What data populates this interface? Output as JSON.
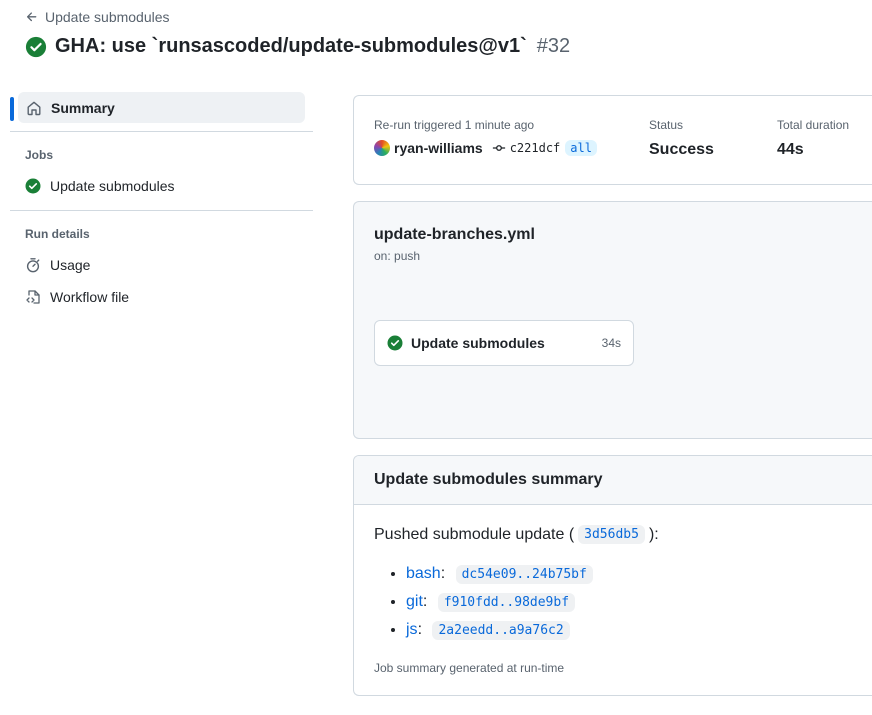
{
  "header": {
    "back_label": "Update submodules",
    "title": "GHA: use `runsascoded/update-submodules@v1`",
    "run_number": "#32"
  },
  "sidebar": {
    "summary_label": "Summary",
    "jobs_heading": "Jobs",
    "jobs": [
      {
        "label": "Update submodules",
        "status": "success"
      }
    ],
    "run_details_heading": "Run details",
    "run_details": [
      {
        "label": "Usage",
        "icon": "stopwatch-icon"
      },
      {
        "label": "Workflow file",
        "icon": "file-code-icon"
      }
    ]
  },
  "run_info": {
    "trigger_label": "Re-run triggered 1 minute ago",
    "actor": "ryan-williams",
    "commit_sha": "c221dcf",
    "branch": "all",
    "status_label": "Status",
    "status_value": "Success",
    "duration_label": "Total duration",
    "duration_value": "44s"
  },
  "workflow": {
    "file": "update-branches.yml",
    "trigger": "on: push",
    "job": {
      "name": "Update submodules",
      "duration": "34s",
      "status": "success"
    }
  },
  "job_summary": {
    "heading": "Update submodules summary",
    "pushed_prefix": "Pushed submodule update (",
    "pushed_sha": "3d56db5",
    "pushed_suffix": "):",
    "submodules": [
      {
        "name": "bash",
        "range": "dc54e09..24b75bf"
      },
      {
        "name": "git",
        "range": "f910fdd..98de9bf"
      },
      {
        "name": "js",
        "range": "2a2eedd..a9a76c2"
      }
    ],
    "footer": "Job summary generated at run-time"
  },
  "colors": {
    "success": "#1a7f37",
    "link": "#0969da",
    "active_indicator": "#0969da",
    "muted_text": "#59636e",
    "border": "#d1d9e0"
  }
}
